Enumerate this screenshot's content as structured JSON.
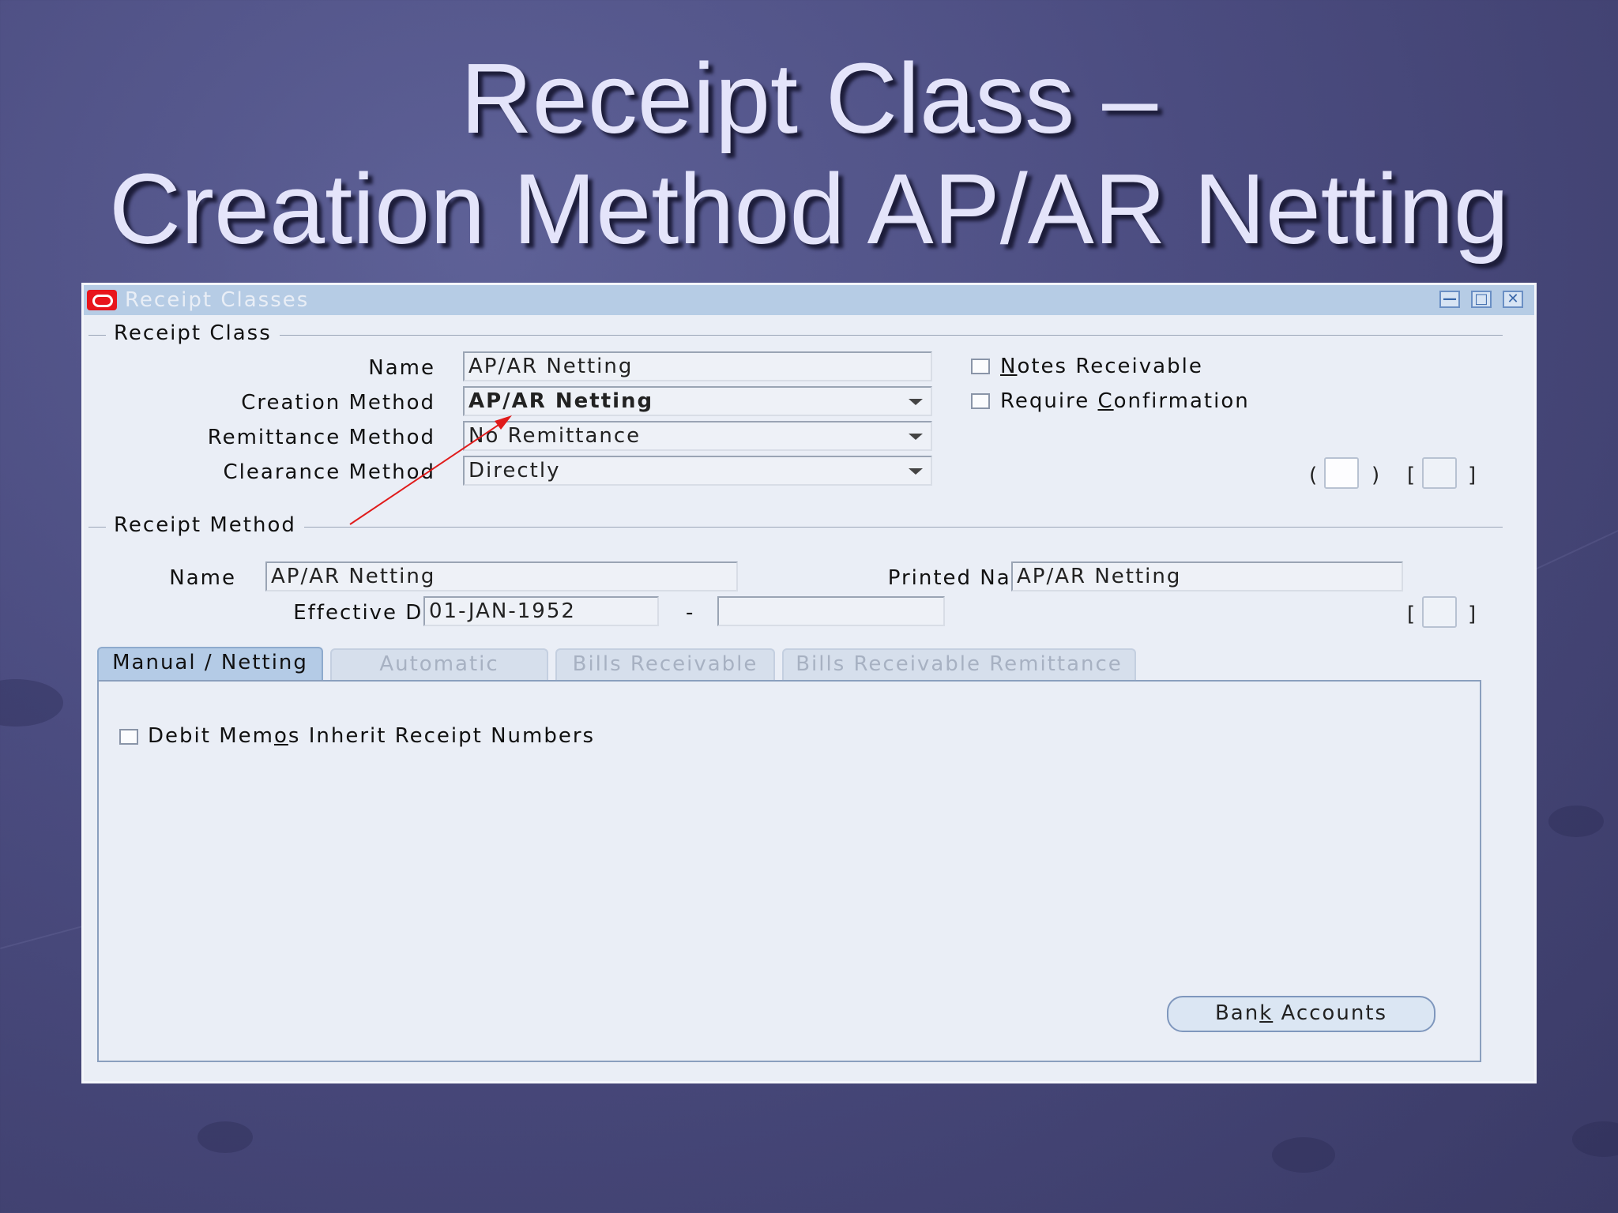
{
  "slide": {
    "title_line1": "Receipt Class –",
    "title_line2": "Creation Method AP/AR Netting"
  },
  "window": {
    "title": "Receipt Classes",
    "controls": {
      "minimize": "—",
      "maximize": "□",
      "close": "✕"
    }
  },
  "receipt_class": {
    "section_label": "Receipt Class",
    "name_label": "Name",
    "name_value": "AP/AR Netting",
    "creation_method_label": "Creation Method",
    "creation_method_value": "AP/AR Netting",
    "remittance_method_label": "Remittance Method",
    "remittance_method_value": "No Remittance",
    "clearance_method_label": "Clearance Method",
    "clearance_method_value": "Directly",
    "notes_receivable_label_pre": "",
    "notes_receivable_label_u": "N",
    "notes_receivable_label_post": "otes Receivable",
    "require_confirmation_label_pre": "Require ",
    "require_confirmation_label_u": "C",
    "require_confirmation_label_post": "onfirmation",
    "paren_open": "(",
    "paren_close": ")",
    "bracket_open": "[",
    "bracket_close": "]"
  },
  "receipt_method": {
    "section_label": "Receipt Method",
    "name_label": "Name",
    "name_value": "AP/AR Netting",
    "printed_name_label": "Printed Name",
    "printed_name_value": "AP/AR Netting",
    "effective_dates_label": "Effective Dates",
    "effective_from": "01-JAN-1952",
    "date_separator": "-",
    "effective_to": "",
    "bracket_open": "[",
    "bracket_close": "]"
  },
  "tabs": [
    {
      "label": "Manual / Netting",
      "active": true
    },
    {
      "label": "Automatic",
      "active": false
    },
    {
      "label": "Bills Receivable",
      "active": false
    },
    {
      "label": "Bills Receivable Remittance",
      "active": false
    }
  ],
  "tab_panel": {
    "debit_memos_label_pre": "Debit Mem",
    "debit_memos_label_u": "o",
    "debit_memos_label_post": "s Inherit Receipt Numbers",
    "bank_accounts_pre": "Ban",
    "bank_accounts_u": "k",
    "bank_accounts_post": " Accounts"
  },
  "colors": {
    "annotation_arrow": "#e01b1b",
    "titlebar": "#b6cce5",
    "active_tab": "#b4cbe6"
  }
}
